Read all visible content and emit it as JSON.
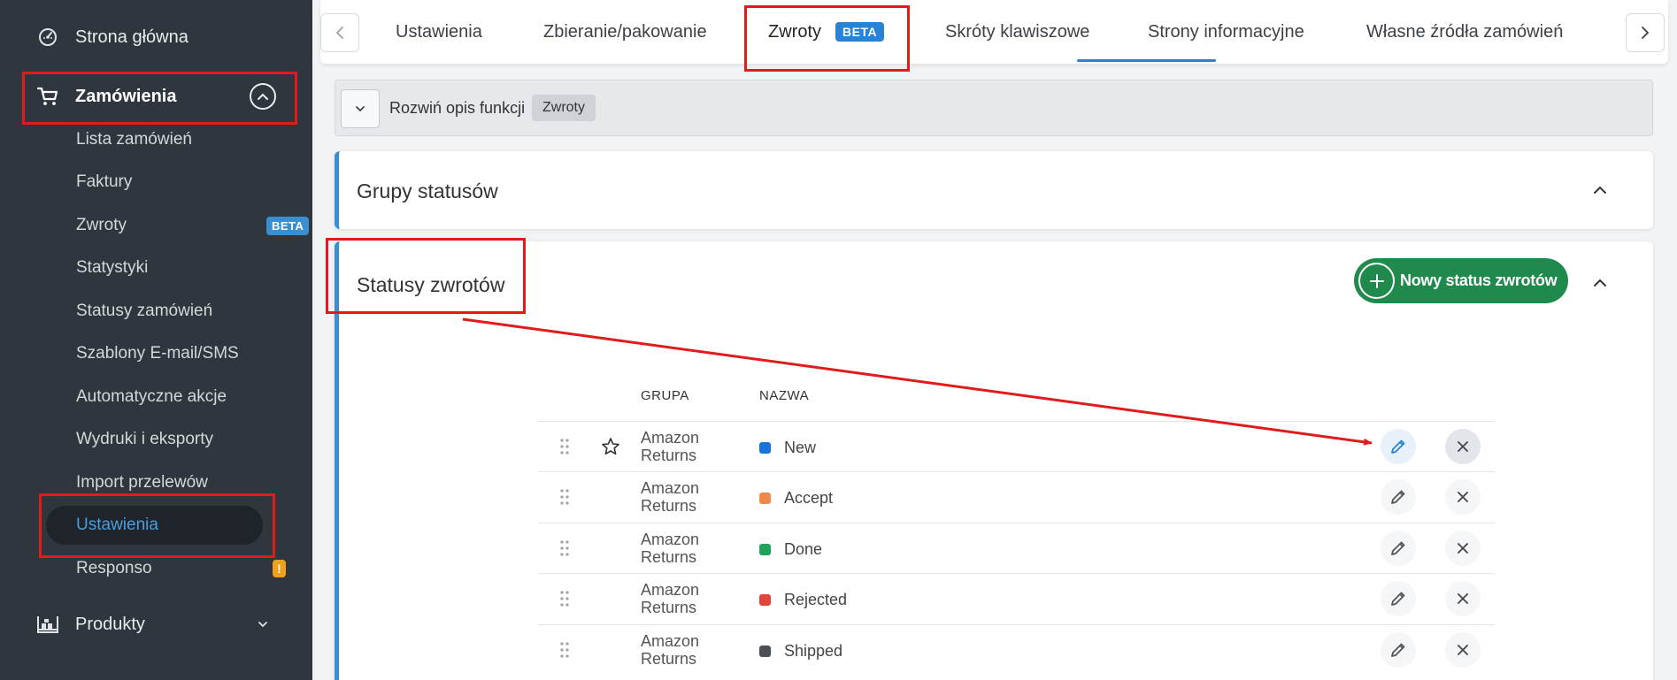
{
  "sidebar": {
    "home": "Strona główna",
    "orders": "Zamówienia",
    "items": [
      "Lista zamówień",
      "Faktury",
      "Zwroty",
      "Statystyki",
      "Statusy zamówień",
      "Szablony E-mail/SMS",
      "Automatyczne akcje",
      "Wydruki i eksporty",
      "Import przelewów",
      "Ustawienia",
      "Responso"
    ],
    "beta_badge": "BETA",
    "warn_badge": "!",
    "products": "Produkty"
  },
  "tabs": {
    "items": [
      "Ustawienia",
      "Zbieranie/pakowanie",
      "Zwroty",
      "Skróty klawiszowe",
      "Strony informacyjne",
      "Własne źródła zamówień"
    ],
    "active_badge": "BETA"
  },
  "description": {
    "toggle_label": "Rozwiń opis funkcji",
    "tag": "Zwroty"
  },
  "panels": {
    "groups_title": "Grupy statusów",
    "statuses_title": "Statusy zwrotów",
    "new_button": "Nowy status zwrotów"
  },
  "table": {
    "col_group": "GRUPA",
    "col_name": "NAZWA",
    "rows": [
      {
        "group1": "Amazon",
        "group2": "Returns",
        "name": "New",
        "color": "#1a73d9"
      },
      {
        "group1": "Amazon",
        "group2": "Returns",
        "name": "Accept",
        "color": "#f0894a"
      },
      {
        "group1": "Amazon",
        "group2": "Returns",
        "name": "Done",
        "color": "#1fa35c"
      },
      {
        "group1": "Amazon",
        "group2": "Returns",
        "name": "Rejected",
        "color": "#e0443a"
      },
      {
        "group1": "Amazon",
        "group2": "Returns",
        "name": "Shipped",
        "color": "#4a5058"
      }
    ]
  },
  "colors": {
    "sidebar_bg": "#2f363e",
    "accent_blue": "#2a83d2",
    "primary_green": "#1f8a4c",
    "annotation_red": "#e01b1b"
  }
}
